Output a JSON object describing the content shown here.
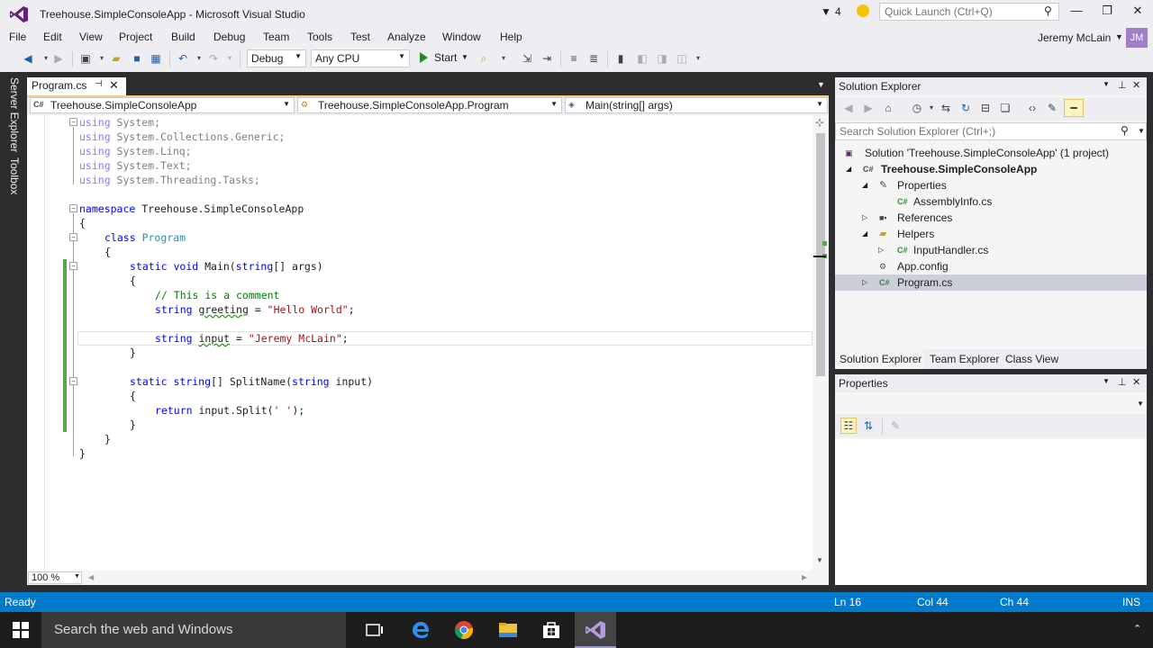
{
  "window": {
    "title": "Treehouse.SimpleConsoleApp - Microsoft Visual Studio",
    "notification_count": "4",
    "quick_launch_placeholder": "Quick Launch (Ctrl+Q)",
    "user_name": "Jeremy McLain",
    "user_initials": "JM"
  },
  "menu": [
    "File",
    "Edit",
    "View",
    "Project",
    "Build",
    "Debug",
    "Team",
    "Tools",
    "Test",
    "Analyze",
    "Window",
    "Help"
  ],
  "toolbar": {
    "configuration": "Debug",
    "platform": "Any CPU",
    "start_label": "Start"
  },
  "side_tabs": [
    "Server Explorer",
    "Toolbox"
  ],
  "editor": {
    "tab_label": "Program.cs",
    "nav_project": "Treehouse.SimpleConsoleApp",
    "nav_class": "Treehouse.SimpleConsoleApp.Program",
    "nav_member": "Main(string[] args)",
    "zoom": "100 %",
    "lines": {
      "l1_kw": "using",
      "l1_rest": " System;",
      "l2_kw": "using",
      "l2_rest": " System.Collections.Generic;",
      "l3_kw": "using",
      "l3_rest": " System.Linq;",
      "l4_kw": "using",
      "l4_rest": " System.Text;",
      "l5_kw": "using",
      "l5_rest": " System.Threading.Tasks;",
      "ns_kw": "namespace",
      "ns_name": " Treehouse.SimpleConsoleApp",
      "brace_open": "{",
      "class_kw": "class",
      "class_name": "Program",
      "static_kw": "static",
      "void_kw": "void",
      "main_name": " Main(",
      "string_kw": "string",
      "main_args": "[] args)",
      "comment": "// This is a comment",
      "greeting_name": "greeting",
      "greeting_eq": " = ",
      "greeting_val": "\"Hello World\"",
      "semicolon": ";",
      "input_name": "input",
      "input_val": "\"Jeremy McLain\"",
      "brace_close": "}",
      "split_sig": " SplitName(",
      "split_args": " input)",
      "split_arr": "[]",
      "return_kw": "return",
      "return_rest": " input.Split(",
      "return_char": "' '",
      "return_end": ");"
    }
  },
  "solution_explorer": {
    "title": "Solution Explorer",
    "search_placeholder": "Search Solution Explorer (Ctrl+;)",
    "tree": [
      "Solution 'Treehouse.SimpleConsoleApp' (1 project)",
      "Treehouse.SimpleConsoleApp",
      "Properties",
      "AssemblyInfo.cs",
      "References",
      "Helpers",
      "InputHandler.cs",
      "App.config",
      "Program.cs"
    ],
    "tabs": [
      "Solution Explorer",
      "Team Explorer",
      "Class View"
    ]
  },
  "properties": {
    "title": "Properties"
  },
  "status": {
    "state": "Ready",
    "line": "Ln 16",
    "col": "Col 44",
    "ch": "Ch 44",
    "mode": "INS"
  },
  "taskbar": {
    "search_placeholder": "Search the web and Windows"
  },
  "colors": {
    "status_bar": "#007acc",
    "frame": "#2d2d30",
    "keyword": "#0000ff",
    "type": "#2b91af",
    "string": "#a31515",
    "comment": "#008000",
    "vs_purple": "#68217a"
  }
}
